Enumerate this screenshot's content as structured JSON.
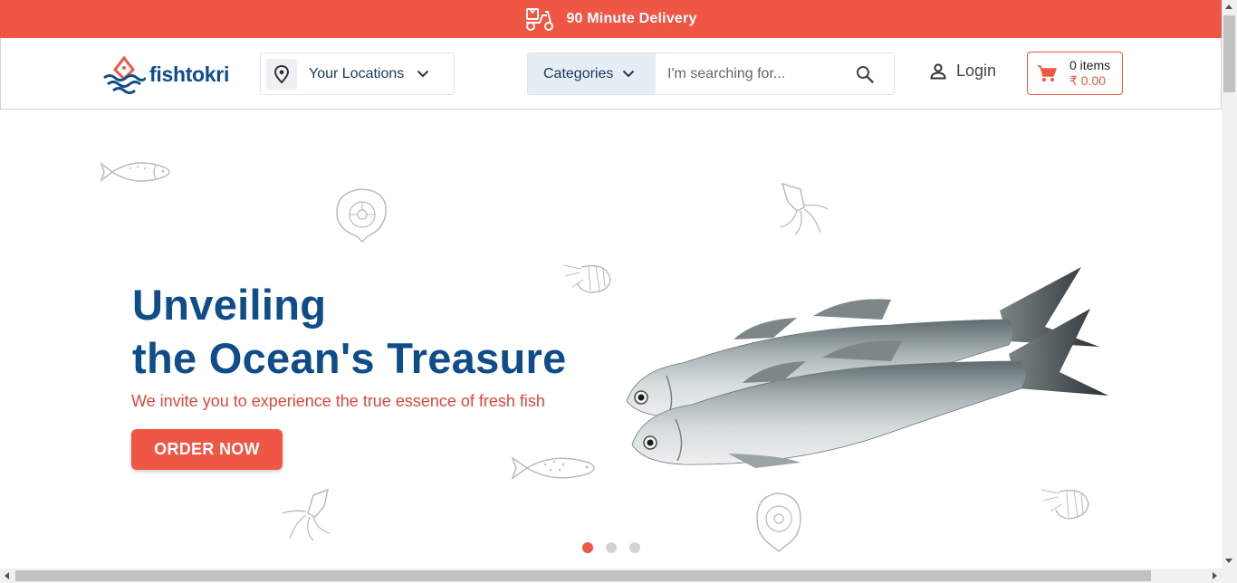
{
  "announcement": {
    "text": "90 Minute Delivery",
    "icon": "delivery-scooter-icon"
  },
  "header": {
    "logo_text": "fishtokri",
    "location_label": "Your Locations",
    "categories_label": "Categories",
    "search_placeholder": "I'm searching for...",
    "login_label": "Login",
    "cart": {
      "items_label": "0 items",
      "total_label": "₹ 0.00"
    }
  },
  "hero": {
    "title_line1": "Unveiling",
    "title_line2": "the Ocean's Treasure",
    "subtitle": "We invite you to experience the true essence of fresh fish",
    "cta_label": "ORDER NOW",
    "slide_count": 3,
    "active_slide": 1
  },
  "colors": {
    "brand_red": "#f05644",
    "brand_blue": "#0f4c8a",
    "category_bg": "#e6edf5"
  }
}
